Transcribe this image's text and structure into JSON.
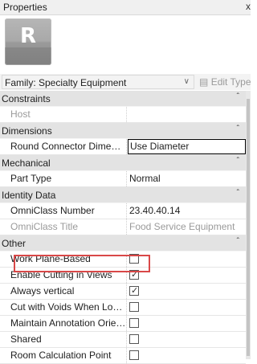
{
  "window": {
    "title": "Properties",
    "close_glyph": "x"
  },
  "logo": {
    "letter": "R"
  },
  "family": {
    "label": "Family: Specialty Equipment",
    "edit_type_label": "Edit Type"
  },
  "sections": {
    "constraints": "Constraints",
    "dimensions": "Dimensions",
    "mechanical": "Mechanical",
    "identity": "Identity Data",
    "other": "Other"
  },
  "rows": {
    "host": {
      "name": "Host",
      "value": ""
    },
    "round_connector": {
      "name": "Round Connector Dimension",
      "value": "Use Diameter"
    },
    "part_type": {
      "name": "Part Type",
      "value": "Normal"
    },
    "omniclass_number": {
      "name": "OmniClass Number",
      "value": "23.40.40.14"
    },
    "omniclass_title": {
      "name": "OmniClass Title",
      "value": "Food Service Equipment"
    },
    "work_plane": {
      "name": "Work Plane-Based",
      "checked": false
    },
    "enable_cutting": {
      "name": "Enable Cutting in Views",
      "checked": true
    },
    "always_vertical": {
      "name": "Always vertical",
      "checked": true
    },
    "cut_with_voids": {
      "name": "Cut with Voids When Loaded",
      "checked": false
    },
    "maintain_annotation": {
      "name": "Maintain Annotation Orientation",
      "checked": false
    },
    "shared": {
      "name": "Shared",
      "checked": false
    },
    "room_calc": {
      "name": "Room Calculation Point",
      "checked": false
    }
  }
}
